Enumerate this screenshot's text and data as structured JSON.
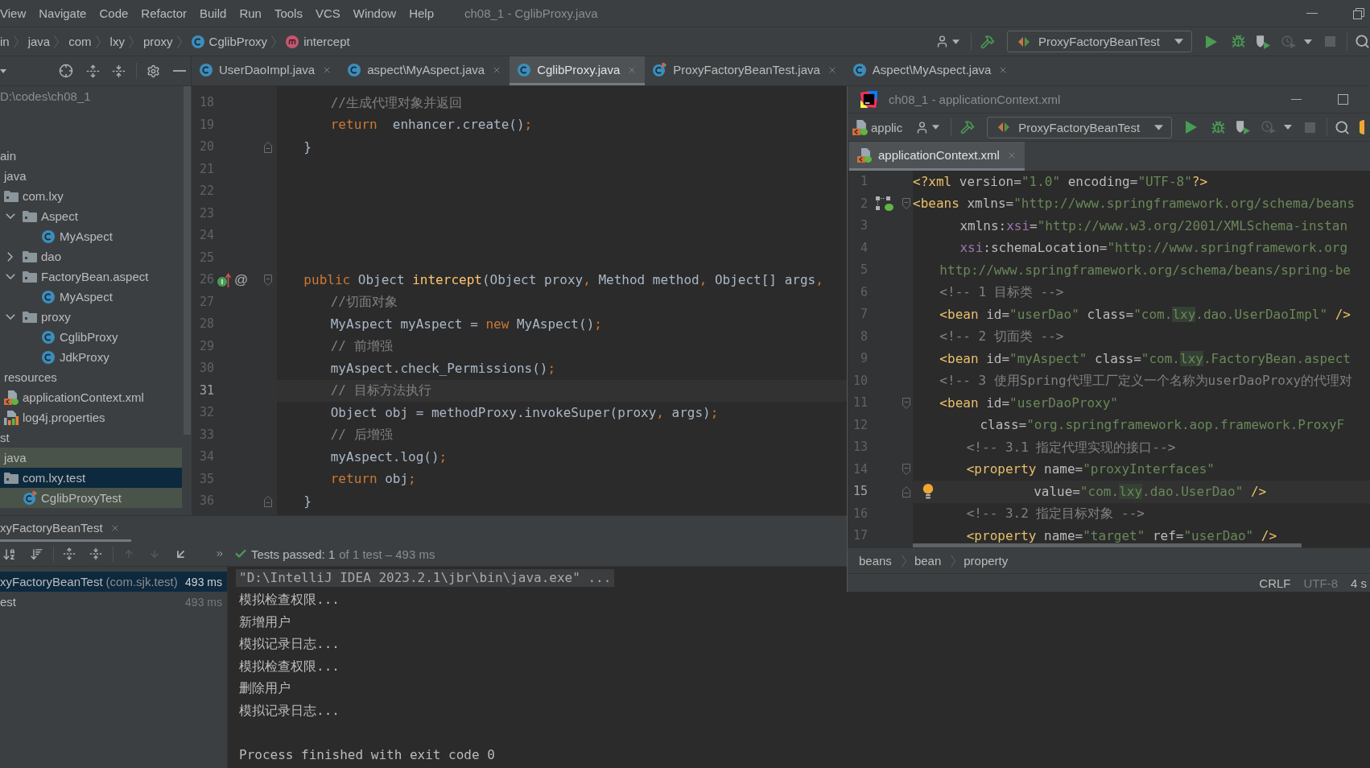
{
  "menu_bar": {
    "items": [
      "View",
      "Navigate",
      "Code",
      "Refactor",
      "Build",
      "Run",
      "Tools",
      "VCS",
      "Window",
      "Help"
    ],
    "title": "ch08_1 - CglibProxy.java"
  },
  "navigation_bar": {
    "breadcrumbs": [
      {
        "label": "in"
      },
      {
        "label": "java"
      },
      {
        "label": "com"
      },
      {
        "label": "lxy"
      },
      {
        "label": "proxy"
      },
      {
        "label": "CglibProxy",
        "kind": "class"
      },
      {
        "label": "intercept",
        "kind": "method"
      }
    ],
    "run_config": "ProxyFactoryBeanTest"
  },
  "editor_tabs": [
    {
      "label": "UserDaoImpl.java",
      "kind": "class",
      "selected": false
    },
    {
      "label": "aspect\\MyAspect.java",
      "kind": "class",
      "selected": false
    },
    {
      "label": "CglibProxy.java",
      "kind": "class",
      "selected": true
    },
    {
      "label": "ProxyFactoryBeanTest.java",
      "kind": "test_class",
      "selected": false
    },
    {
      "label": "Aspect\\MyAspect.java",
      "kind": "class",
      "selected": false
    }
  ],
  "project_panel": {
    "root_path": "D:\\codes\\ch08_1",
    "tree": [
      {
        "label": "ain",
        "selected": false,
        "tinted": false,
        "children": [
          {
            "label": "java",
            "selected": false,
            "tinted": false,
            "children": [
              {
                "label": "com.lxy",
                "kind": "package",
                "selected": false,
                "tinted": false,
                "children": [
                  {
                    "label": "Aspect",
                    "kind": "package",
                    "expanded": true,
                    "selected": false,
                    "tinted": false,
                    "children": [
                      {
                        "label": "MyAspect",
                        "kind": "class",
                        "selected": false,
                        "tinted": false
                      }
                    ]
                  },
                  {
                    "label": "dao",
                    "kind": "package",
                    "expanded": false,
                    "selected": false,
                    "tinted": false
                  },
                  {
                    "label": "FactoryBean.aspect",
                    "kind": "package",
                    "expanded": true,
                    "selected": false,
                    "tinted": false,
                    "children": [
                      {
                        "label": "MyAspect",
                        "kind": "class",
                        "selected": false,
                        "tinted": false
                      }
                    ]
                  },
                  {
                    "label": "proxy",
                    "kind": "package",
                    "expanded": true,
                    "selected": false,
                    "tinted": false,
                    "children": [
                      {
                        "label": "CglibProxy",
                        "kind": "class",
                        "selected": false,
                        "tinted": false
                      },
                      {
                        "label": "JdkProxy",
                        "kind": "class",
                        "selected": false,
                        "tinted": false
                      }
                    ]
                  }
                ]
              }
            ]
          },
          {
            "label": "resources",
            "selected": false,
            "tinted": false,
            "children": [
              {
                "label": "applicationContext.xml",
                "kind": "xml",
                "selected": false,
                "tinted": false
              },
              {
                "label": "log4j.properties",
                "kind": "properties",
                "selected": false,
                "tinted": false
              }
            ]
          }
        ]
      },
      {
        "label": "st",
        "selected": false,
        "tinted": false,
        "children": [
          {
            "label": "java",
            "selected": false,
            "tinted": true,
            "children": [
              {
                "label": "com.lxy.test",
                "kind": "package",
                "selected": true,
                "children": [
                  {
                    "label": "CglibProxyTest",
                    "kind": "test_class",
                    "selected": false,
                    "tinted": true
                  }
                ]
              }
            ]
          }
        ]
      }
    ]
  },
  "editor": {
    "lines": [
      {
        "number": "18",
        "current": false,
        "segments": [
          {
            "text": "        //生成代理对象并返回",
            "kind": "comment"
          }
        ]
      },
      {
        "number": "19",
        "current": false,
        "segments": [
          {
            "text": "        return",
            "kind": "keyword"
          },
          {
            "text": "  enhancer.create()",
            "kind": "plain"
          },
          {
            "text": ";",
            "kind": "punct"
          }
        ]
      },
      {
        "number": "20",
        "current": false,
        "fold": {
          "kind": "end"
        },
        "segments": [
          {
            "text": "    }",
            "kind": "plain"
          }
        ]
      },
      {
        "number": "21",
        "current": false
      },
      {
        "number": "22",
        "current": false
      },
      {
        "number": "23",
        "current": false
      },
      {
        "number": "24",
        "current": false
      },
      {
        "number": "25",
        "current": false
      },
      {
        "number": "26",
        "current": false,
        "gutter": {
          "kind": "implements"
        },
        "annotation": "@",
        "fold": {
          "kind": "start"
        },
        "segments": [
          {
            "text": "    public",
            "kind": "keyword"
          },
          {
            "text": " Object ",
            "kind": "plain"
          },
          {
            "text": "intercept",
            "kind": "method"
          },
          {
            "text": "(Object proxy",
            "kind": "plain"
          },
          {
            "text": ",",
            "kind": "punct"
          },
          {
            "text": " Method method",
            "kind": "plain"
          },
          {
            "text": ",",
            "kind": "punct"
          },
          {
            "text": " Object[] args",
            "kind": "plain"
          },
          {
            "text": ",",
            "kind": "punct"
          }
        ]
      },
      {
        "number": "27",
        "current": false,
        "segments": [
          {
            "text": "        //切面对象",
            "kind": "comment"
          }
        ]
      },
      {
        "number": "28",
        "current": false,
        "segments": [
          {
            "text": "        MyAspect myAspect = ",
            "kind": "plain"
          },
          {
            "text": "new",
            "kind": "keyword"
          },
          {
            "text": " MyAspect()",
            "kind": "plain"
          },
          {
            "text": ";",
            "kind": "punct"
          }
        ]
      },
      {
        "number": "29",
        "current": false,
        "segments": [
          {
            "text": "        // 前增强",
            "kind": "comment"
          }
        ]
      },
      {
        "number": "30",
        "current": false,
        "segments": [
          {
            "text": "        myAspect.check_Permissions()",
            "kind": "plain"
          },
          {
            "text": ";",
            "kind": "punct"
          }
        ]
      },
      {
        "number": "31",
        "current": true,
        "segments": [
          {
            "text": "        // 目标方法执行",
            "kind": "comment"
          }
        ]
      },
      {
        "number": "32",
        "current": false,
        "segments": [
          {
            "text": "        Object obj = methodProxy.invokeSuper(proxy",
            "kind": "plain"
          },
          {
            "text": ",",
            "kind": "punct"
          },
          {
            "text": " args)",
            "kind": "plain"
          },
          {
            "text": ";",
            "kind": "punct"
          }
        ]
      },
      {
        "number": "33",
        "current": false,
        "segments": [
          {
            "text": "        // 后增强",
            "kind": "comment"
          }
        ]
      },
      {
        "number": "34",
        "current": false,
        "segments": [
          {
            "text": "        myAspect.log()",
            "kind": "plain"
          },
          {
            "text": ";",
            "kind": "punct"
          }
        ]
      },
      {
        "number": "35",
        "current": false,
        "segments": [
          {
            "text": "        return",
            "kind": "keyword"
          },
          {
            "text": " obj",
            "kind": "plain"
          },
          {
            "text": ";",
            "kind": "punct"
          }
        ]
      },
      {
        "number": "36",
        "current": false,
        "fold": {
          "kind": "end"
        },
        "segments": [
          {
            "text": "    }",
            "kind": "plain"
          }
        ]
      }
    ]
  },
  "run_panel": {
    "tab": "xyFactoryBeanTest",
    "summary": {
      "passed": true,
      "status": "Tests passed: 1",
      "detail": "of 1 test – 493 ms"
    },
    "tests": [
      {
        "name": "xyFactoryBeanTest",
        "package": "(com.sjk.test)",
        "time": "493 ms",
        "selected": true
      },
      {
        "name": "est",
        "time": "493 ms",
        "selected": false
      }
    ],
    "console": [
      {
        "text": "\"D:\\IntelliJ IDEA 2023.2.1\\jbr\\bin\\java.exe\" ...",
        "kind": "command"
      },
      {
        "text": "模拟检查权限...",
        "kind": "output"
      },
      {
        "text": "新增用户",
        "kind": "output"
      },
      {
        "text": "模拟记录日志...",
        "kind": "output"
      },
      {
        "text": "模拟检查权限...",
        "kind": "output"
      },
      {
        "text": "删除用户",
        "kind": "output"
      },
      {
        "text": "模拟记录日志...",
        "kind": "output"
      },
      {
        "text": "Process finished with exit code 0",
        "kind": "exit"
      }
    ]
  },
  "xml_window": {
    "title": "ch08_1 - applicationContext.xml",
    "file_label": "applic",
    "run_config": "ProxyFactoryBeanTest",
    "tabs": [
      {
        "label": "applicationContext.xml",
        "kind": "xml",
        "selected": true
      }
    ],
    "lines": [
      {
        "number": "1",
        "current": false,
        "segments": [
          {
            "text": "<?xml",
            "kind": "tag"
          },
          {
            "text": " version=",
            "kind": "attr"
          },
          {
            "text": "\"1.0\"",
            "kind": "value"
          },
          {
            "text": " encoding=",
            "kind": "attr"
          },
          {
            "text": "\"UTF-8\"",
            "kind": "value"
          },
          {
            "text": "?>",
            "kind": "tag"
          }
        ]
      },
      {
        "number": "2",
        "current": false,
        "gutter": {
          "kind": "beans"
        },
        "fold": {
          "kind": "start"
        },
        "segments": [
          {
            "text": "<beans",
            "kind": "tag"
          },
          {
            "text": " xmlns=",
            "kind": "attr"
          },
          {
            "text": "\"http://www.springframework.org/schema/beans",
            "kind": "value"
          }
        ]
      },
      {
        "number": "3",
        "current": false,
        "segments": [
          {
            "text": "       xmlns:",
            "kind": "attr"
          },
          {
            "text": "xsi",
            "kind": "ns"
          },
          {
            "text": "=",
            "kind": "attr"
          },
          {
            "text": "\"http://www.w3.org/2001/XMLSchema-instan",
            "kind": "value"
          }
        ]
      },
      {
        "number": "4",
        "current": false,
        "segments": [
          {
            "text": "       xsi",
            "kind": "ns"
          },
          {
            "text": ":schemaLocation=",
            "kind": "attr"
          },
          {
            "text": "\"http://www.springframework.org",
            "kind": "value"
          }
        ]
      },
      {
        "number": "5",
        "current": false,
        "segments": [
          {
            "text": "    http://www.springframework.org/schema/beans/spring-be",
            "kind": "value"
          }
        ]
      },
      {
        "number": "6",
        "current": false,
        "segments": [
          {
            "text": "    <!-- 1 目标类 -->",
            "kind": "comment"
          }
        ]
      },
      {
        "number": "7",
        "current": false,
        "segments": [
          {
            "text": "    <bean",
            "kind": "tag"
          },
          {
            "text": " id=",
            "kind": "attr"
          },
          {
            "text": "\"userDao\"",
            "kind": "value"
          },
          {
            "text": " class=",
            "kind": "attr"
          },
          {
            "text": "\"com.",
            "kind": "value"
          },
          {
            "text": "lxy",
            "kind": "match"
          },
          {
            "text": ".dao.UserDaoImpl\"",
            "kind": "value"
          },
          {
            "text": " />",
            "kind": "tag"
          }
        ]
      },
      {
        "number": "8",
        "current": false,
        "segments": [
          {
            "text": "    <!-- 2 切面类 -->",
            "kind": "comment"
          }
        ]
      },
      {
        "number": "9",
        "current": false,
        "segments": [
          {
            "text": "    <bean",
            "kind": "tag"
          },
          {
            "text": " id=",
            "kind": "attr"
          },
          {
            "text": "\"myAspect\"",
            "kind": "value"
          },
          {
            "text": " class=",
            "kind": "attr"
          },
          {
            "text": "\"com.",
            "kind": "value"
          },
          {
            "text": "lxy",
            "kind": "match"
          },
          {
            "text": ".FactoryBean.aspect",
            "kind": "value"
          }
        ]
      },
      {
        "number": "10",
        "current": false,
        "segments": [
          {
            "text": "    <!-- 3 使用Spring代理工厂定义一个名称为userDaoProxy的代理对",
            "kind": "comment"
          }
        ]
      },
      {
        "number": "11",
        "current": false,
        "fold": {
          "kind": "start"
        },
        "segments": [
          {
            "text": "    <bean",
            "kind": "tag"
          },
          {
            "text": " id=",
            "kind": "attr"
          },
          {
            "text": "\"userDaoProxy\"",
            "kind": "value"
          }
        ]
      },
      {
        "number": "12",
        "current": false,
        "segments": [
          {
            "text": "          class=",
            "kind": "attr"
          },
          {
            "text": "\"org.springframework.aop.framework.ProxyF",
            "kind": "value"
          }
        ]
      },
      {
        "number": "13",
        "current": false,
        "segments": [
          {
            "text": "        <!-- 3.1 指定代理实现的接口-->",
            "kind": "comment"
          }
        ]
      },
      {
        "number": "14",
        "current": false,
        "fold": {
          "kind": "start"
        },
        "segments": [
          {
            "text": "        <property",
            "kind": "tag"
          },
          {
            "text": " name=",
            "kind": "attr"
          },
          {
            "text": "\"proxyInterfaces\"",
            "kind": "value"
          }
        ]
      },
      {
        "number": "15",
        "current": true,
        "fold": {
          "kind": "end"
        },
        "gutter": {
          "kind": "bulb"
        },
        "segments": [
          {
            "text": "                  value=",
            "kind": "attr"
          },
          {
            "text": "\"com.",
            "kind": "value"
          },
          {
            "text": "lxy",
            "kind": "match"
          },
          {
            "text": ".dao.UserDao\"",
            "kind": "value"
          },
          {
            "text": " />",
            "kind": "tag"
          }
        ]
      },
      {
        "number": "16",
        "current": false,
        "segments": [
          {
            "text": "        <!-- 3.2 指定目标对象 -->",
            "kind": "comment"
          }
        ]
      },
      {
        "number": "17",
        "current": false,
        "segments": [
          {
            "text": "        <property",
            "kind": "tag"
          },
          {
            "text": " name=",
            "kind": "attr"
          },
          {
            "text": "\"target\"",
            "kind": "value"
          },
          {
            "text": " ref=",
            "kind": "attr"
          },
          {
            "text": "\"userDao\"",
            "kind": "value"
          },
          {
            "text": " />",
            "kind": "tag"
          }
        ]
      }
    ],
    "breadcrumbs": [
      "beans",
      "bean",
      "property"
    ],
    "status": [
      {
        "label": "CRLF",
        "disabled": false
      },
      {
        "label": "UTF-8",
        "disabled": true
      },
      {
        "label": "4 s",
        "disabled": false
      }
    ]
  }
}
